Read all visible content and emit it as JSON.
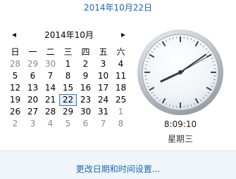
{
  "header": {
    "date_link": "2014年10月22日"
  },
  "calendar": {
    "prev_icon": "◀",
    "next_icon": "▶",
    "month_title": "2014年10月",
    "weekdays": [
      "日",
      "一",
      "二",
      "三",
      "四",
      "五",
      "六"
    ],
    "weeks": [
      [
        {
          "d": "28",
          "other": true
        },
        {
          "d": "29",
          "other": true
        },
        {
          "d": "30",
          "other": true
        },
        {
          "d": "1"
        },
        {
          "d": "2"
        },
        {
          "d": "3"
        },
        {
          "d": "4"
        }
      ],
      [
        {
          "d": "5"
        },
        {
          "d": "6"
        },
        {
          "d": "7"
        },
        {
          "d": "8"
        },
        {
          "d": "9"
        },
        {
          "d": "10"
        },
        {
          "d": "11"
        }
      ],
      [
        {
          "d": "12"
        },
        {
          "d": "13"
        },
        {
          "d": "14"
        },
        {
          "d": "15"
        },
        {
          "d": "16"
        },
        {
          "d": "17"
        },
        {
          "d": "18"
        }
      ],
      [
        {
          "d": "19"
        },
        {
          "d": "20"
        },
        {
          "d": "21"
        },
        {
          "d": "22",
          "selected": true
        },
        {
          "d": "23"
        },
        {
          "d": "24"
        },
        {
          "d": "25"
        }
      ],
      [
        {
          "d": "26"
        },
        {
          "d": "27"
        },
        {
          "d": "28"
        },
        {
          "d": "29"
        },
        {
          "d": "30"
        },
        {
          "d": "31"
        },
        {
          "d": "1",
          "other": true
        }
      ],
      [
        {
          "d": "2",
          "other": true
        },
        {
          "d": "3",
          "other": true
        },
        {
          "d": "4",
          "other": true
        },
        {
          "d": "5",
          "other": true
        },
        {
          "d": "6",
          "other": true
        },
        {
          "d": "7",
          "other": true
        },
        {
          "d": "8",
          "other": true
        }
      ]
    ]
  },
  "clock": {
    "hour": 8,
    "minute": 9,
    "second": 10,
    "time_text": "8:09:10",
    "weekday_text": "星期三"
  },
  "footer": {
    "settings_link": "更改日期和时间设置..."
  },
  "colors": {
    "link": "#1f64b4",
    "selection_border": "#3f7bbf",
    "footer_bg": "#f0f5fb"
  }
}
